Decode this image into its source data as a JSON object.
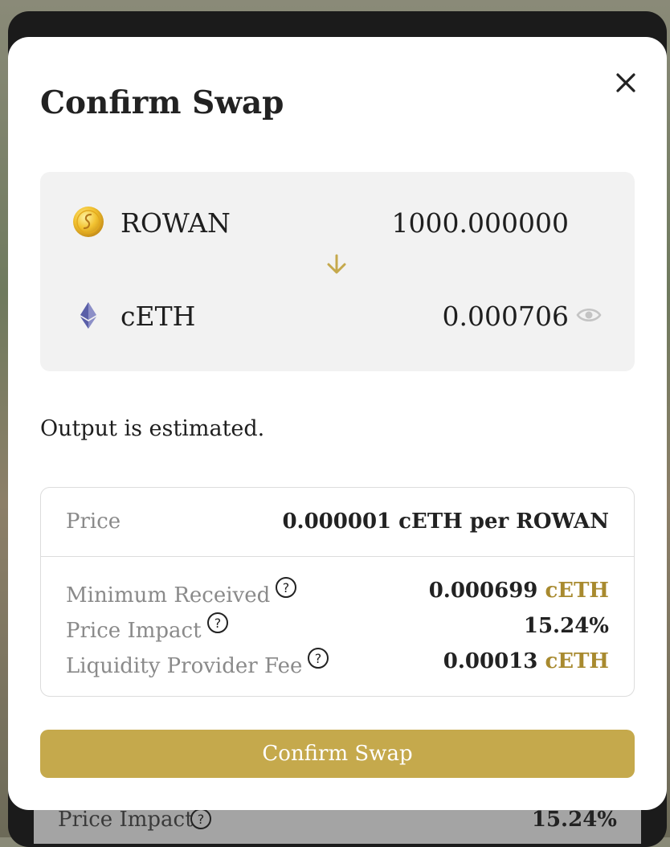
{
  "modal": {
    "title": "Confirm Swap",
    "close_icon": "close-icon"
  },
  "swap": {
    "from": {
      "symbol": "ROWAN",
      "amount": "1000.000000",
      "icon": "rowan-token-icon"
    },
    "to": {
      "symbol": "cETH",
      "amount": "0.000706",
      "icon": "eth-token-icon"
    },
    "direction_icon": "arrow-down-icon",
    "visibility_icon": "eye-icon"
  },
  "note": "Output is estimated.",
  "details": {
    "price_label": "Price",
    "price_value": "0.000001 cETH per ROWAN",
    "min_received_label": "Minimum Received",
    "min_received_value": "0.000699",
    "min_received_unit": "cETH",
    "price_impact_label": "Price Impact",
    "price_impact_value": "15.24%",
    "lp_fee_label": "Liquidity Provider Fee",
    "lp_fee_value": "0.00013",
    "lp_fee_unit": "cETH",
    "help_icon": "help-icon"
  },
  "confirm_label": "Confirm Swap",
  "background": {
    "price_impact_label": "Price Impact",
    "price_impact_value": "15.24%"
  },
  "colors": {
    "accent": "#c5a94c",
    "accent_text": "#a88a2f",
    "panel": "#f2f2f2"
  }
}
